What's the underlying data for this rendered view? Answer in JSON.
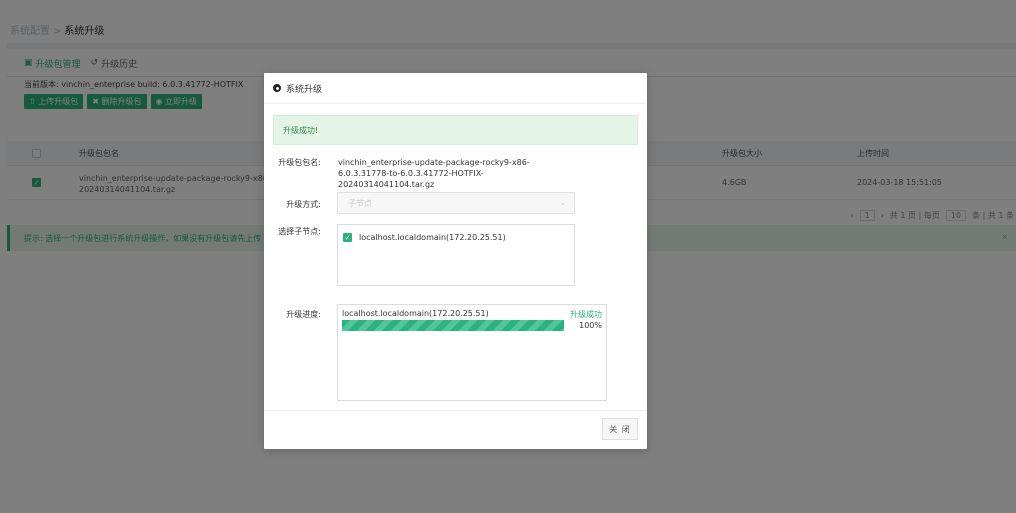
{
  "breadcrumb": {
    "parent": "系统配置",
    "separator": ">",
    "current": "系统升级"
  },
  "tabs": [
    {
      "label": "升级包管理",
      "icon": "package-icon"
    },
    {
      "label": "升级历史",
      "icon": "history-icon"
    }
  ],
  "version": {
    "label": "当前版本: vinchin_enterprise build: 6.0.3.41772-HOTFIX"
  },
  "toolbar": {
    "upload_label": "上传升级包",
    "delete_label": "删除升级包",
    "upgrade_label": "立即升级"
  },
  "table": {
    "columns": [
      "升级包包名",
      "升级包大小",
      "上传时间"
    ],
    "rows": [
      {
        "name": "vinchin_enterprise-update-package-rocky9-x86-6.0.3.31778-to-6.0.3.41772-HOTFIX-20240314041104.tar.gz",
        "name_visible_line1": "vinchin_enterprise-update-package-rocky9-x86-6",
        "name_visible_line2": "20240314041104.tar.gz",
        "size": "4.6GB",
        "time": "2024-03-18 15:51:05"
      }
    ]
  },
  "pager": {
    "page": "1",
    "summary_prefix": "共 1 页 | 每页",
    "page_size": "10",
    "summary_suffix": "条 | 共 1 条"
  },
  "tip": {
    "text": "提示: 选择一个升级包进行系统升级操作，如果没有升级包请先上传"
  },
  "modal": {
    "title": "系统升级",
    "success_message": "升级成功!",
    "package_label": "升级包包名:",
    "package_value": "vinchin_enterprise-update-package-rocky9-x86-6.0.3.31778-to-6.0.3.41772-HOTFIX-20240314041104.tar.gz",
    "mode_label": "升级方式:",
    "mode_value": "子节点",
    "nodes_label": "选择子节点:",
    "node_item": "localhost.localdomain(172.20.25.51)",
    "progress_label": "升级进度:",
    "progress": {
      "host": "localhost.localdomain(172.20.25.51)",
      "status": "升级成功",
      "percent_label": "100%",
      "percent": 100
    },
    "close_label": "关 闭"
  },
  "colors": {
    "accent": "#2bb27d",
    "success_bg": "#e4f4e7",
    "overlay": "rgba(0,0,0,0.5)"
  }
}
